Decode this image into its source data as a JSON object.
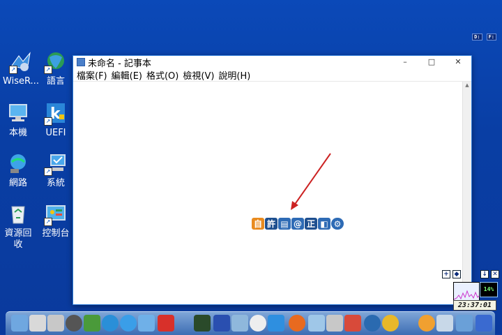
{
  "desktop": {
    "drives": [
      "D:",
      "F:"
    ],
    "icons": [
      {
        "label": "WiseR...",
        "icon": "wise-care-icon"
      },
      {
        "label": "語言",
        "icon": "globe-icon"
      },
      {
        "label": "本機",
        "icon": "computer-icon"
      },
      {
        "label": "UEFI",
        "icon": "uefi-icon"
      },
      {
        "label": "網路",
        "icon": "network-icon"
      },
      {
        "label": "系統",
        "icon": "system-icon"
      },
      {
        "label": "資源回收",
        "icon": "recycle-bin-icon"
      },
      {
        "label": "控制台",
        "icon": "control-panel-icon"
      }
    ]
  },
  "notepad": {
    "title": "未命名 - 記事本",
    "minimize": "–",
    "maximize": "□",
    "close": "✕",
    "menu": [
      "檔案(F)",
      "編輯(E)",
      "格式(O)",
      "檢視(V)",
      "說明(H)"
    ],
    "content": ""
  },
  "ime_bar": {
    "keys": [
      {
        "label": "自",
        "color": "#e98b1f"
      },
      {
        "label": "許",
        "color": "#1e4f8f"
      },
      {
        "label": "▤",
        "color": "#2e6bb5"
      },
      {
        "label": "@",
        "color": "#2e6bb5"
      },
      {
        "label": "正",
        "color": "#1e4f8f"
      },
      {
        "label": "◧",
        "color": "#2e6bb5"
      },
      {
        "label": "⚙",
        "color": "#2e6bb5"
      }
    ]
  },
  "system_widgets": {
    "cpu_percent": "14%",
    "clock": "23:37:01"
  },
  "colors": {
    "desktop": "#0a3fa6",
    "window_border": "#2b78d6",
    "arrow": "#cc2222"
  }
}
